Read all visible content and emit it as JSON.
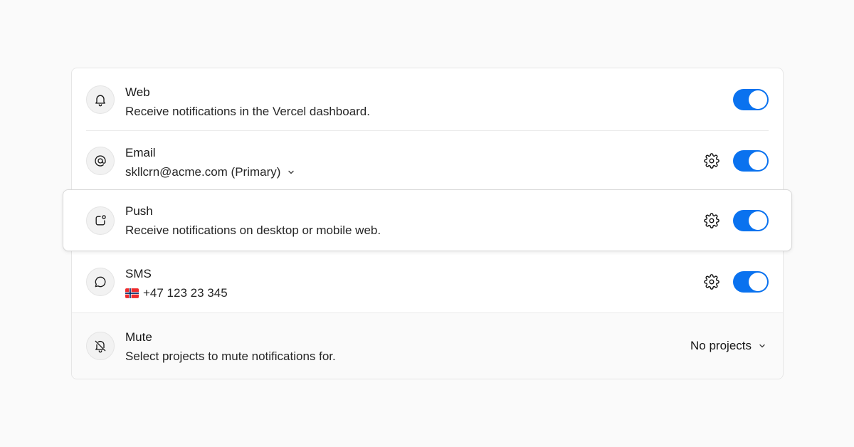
{
  "settings": {
    "web": {
      "title": "Web",
      "description": "Receive notifications in the Vercel dashboard.",
      "enabled": true
    },
    "email": {
      "title": "Email",
      "address": "skllcrn@acme.com (Primary)",
      "enabled": true
    },
    "push": {
      "title": "Push",
      "description": "Receive notifications on desktop or mobile web.",
      "enabled": true
    },
    "sms": {
      "title": "SMS",
      "phone": "+47 123 23 345",
      "enabled": true
    },
    "mute": {
      "title": "Mute",
      "description": "Select projects to mute notifications for.",
      "selected": "No projects"
    }
  },
  "colors": {
    "accent": "#0a72ef",
    "background": "#fafafa",
    "card": "#ffffff"
  },
  "icons": [
    "bell-icon",
    "at-sign-icon",
    "push-notification-icon",
    "message-bubble-icon",
    "bell-off-icon",
    "gear-icon",
    "chevron-down-icon",
    "norway-flag-icon"
  ]
}
